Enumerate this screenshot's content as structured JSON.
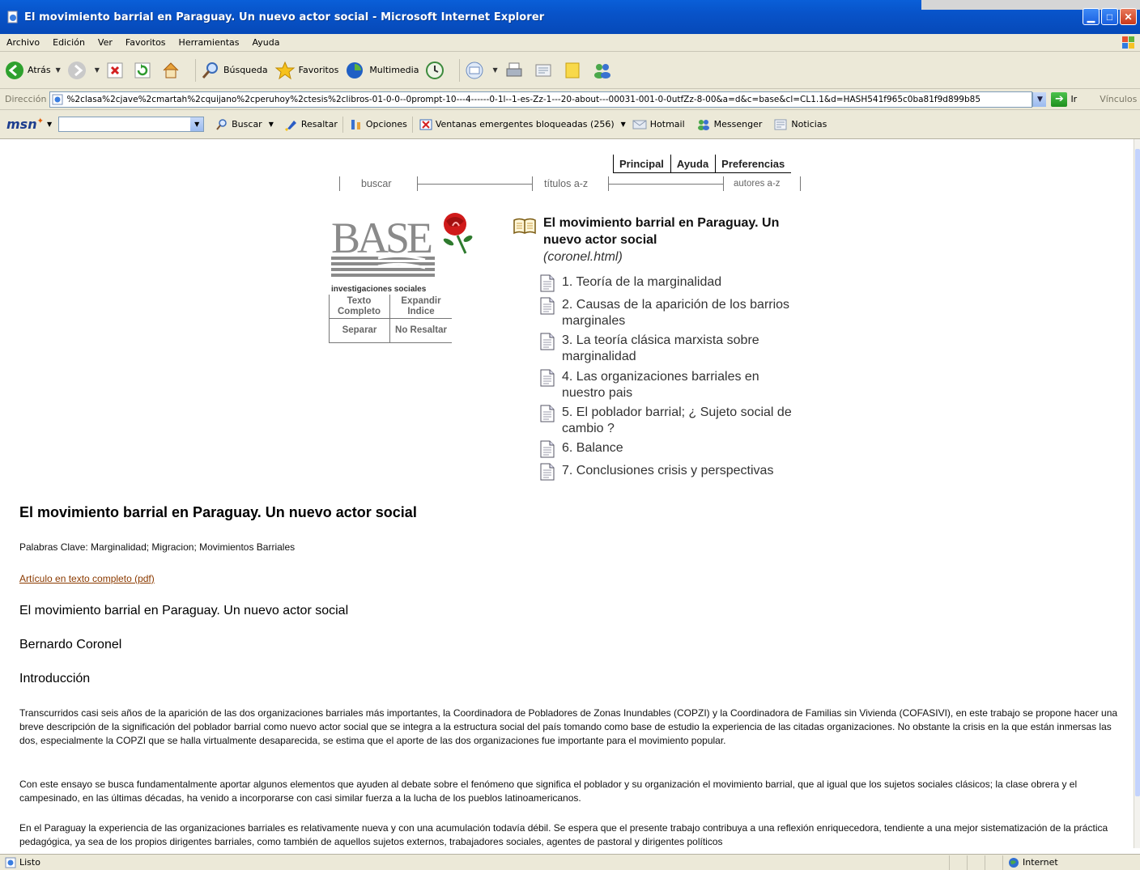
{
  "window": {
    "title": "El movimiento barrial en Paraguay. Un nuevo actor social - Microsoft Internet Explorer"
  },
  "menu": [
    "Archivo",
    "Edición",
    "Ver",
    "Favoritos",
    "Herramientas",
    "Ayuda"
  ],
  "toolbar": {
    "back": "Atrás",
    "search": "Búsqueda",
    "favorites": "Favoritos",
    "media": "Multimedia"
  },
  "address": {
    "label": "Dirección",
    "url": "%2clasa%2cjave%2cmartah%2cquijano%2cperuhoy%2ctesis%2clibros-01-0-0--0prompt-10---4------0-1l--1-es-Zz-1---20-about---00031-001-0-0utfZz-8-00&a=d&c=base&cl=CL1.1&d=HASH541f965c0ba81f9d899b85",
    "go": "Ir",
    "links": "Vínculos"
  },
  "msn": {
    "search": "Buscar",
    "highlight": "Resaltar",
    "options": "Opciones",
    "popups": "Ventanas emergentes bloqueadas (256)",
    "hotmail": "Hotmail",
    "messenger": "Messenger",
    "news": "Noticias"
  },
  "nav": {
    "principal": "Principal",
    "ayuda": "Ayuda",
    "preferencias": "Preferencias",
    "buscar": "buscar",
    "titulos": "títulos a-z",
    "autores": "autores a-z"
  },
  "logo": {
    "text": "BASE",
    "subtitle": "investigaciones sociales"
  },
  "buttons": {
    "texto_completo": "Texto Completo",
    "expandir_indice": "Expandir Indice",
    "separar": "Separar",
    "no_resaltar": "No Resaltar"
  },
  "toc": {
    "title": "El movimiento barrial en Paraguay. Un nuevo actor social",
    "file": "(coronel.html)",
    "items": [
      "1. Teoría de la marginalidad",
      "2. Causas de la aparición de los barrios marginales",
      "3. La teoría clásica marxista sobre marginalidad",
      "4. Las organizaciones barriales en nuestro pais",
      "5. El poblador barrial; ¿ Sujeto social de cambio ?",
      "6. Balance",
      "7. Conclusiones crisis y perspectivas"
    ]
  },
  "article": {
    "heading": "El movimiento barrial en Paraguay. Un nuevo actor social",
    "keywords": "Palabras Clave: Marginalidad; Migracion; Movimientos Barriales",
    "pdf_link": "Artículo en texto completo (pdf)",
    "subheading": "El movimiento barrial en Paraguay. Un nuevo actor social",
    "author": "Bernardo Coronel",
    "intro_heading": "Introducción",
    "paragraphs": [
      "Transcurridos casi seis años de la aparición de las dos organizaciones barriales más importantes, la Coordinadora de Pobladores de Zonas Inundables (COPZI) y la Coordinadora de Familias sin Vivienda (COFASIVI), en este trabajo se propone hacer una breve descripción de la significación del poblador barrial como nuevo actor social que se integra a la estructura social del país tomando como base de estudio la experiencia de las citadas organizaciones. No obstante la crisis en la que están inmersas las dos, especialmente la COPZI que se halla virtualmente desaparecida, se estima que el aporte de las dos organizaciones fue importante para el movimiento popular.",
      "Con este ensayo se busca fundamentalmente aportar algunos elementos que ayuden al debate sobre el fenómeno que significa el poblador y su organización el movimiento barrial, que al igual que los sujetos sociales clásicos; la clase obrera y el campesinado, en las últimas décadas, ha venido a incorporarse con casi similar fuerza a la lucha de los pueblos latinoamericanos.",
      "En el Paraguay la experiencia de las organizaciones barriales es relativamente nueva y con una acumulación todavía débil. Se espera que el presente trabajo contribuya a una reflexión enriquecedora, tendiente a una mejor sistematización de la práctica pedagógica, ya sea de los propios dirigentes barriales, como también de aquellos sujetos externos, trabajadores sociales, agentes de pastoral y dirigentes políticos"
    ]
  },
  "status": {
    "left": "Listo",
    "zone": "Internet"
  }
}
